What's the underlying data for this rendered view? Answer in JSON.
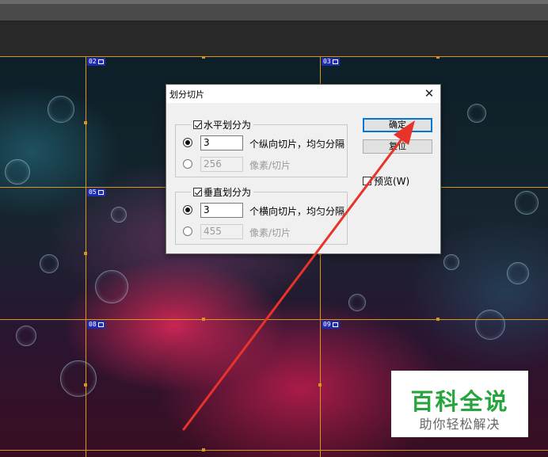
{
  "dialog": {
    "title": "划分切片",
    "close_glyph": "✕",
    "horizontal": {
      "label": "水平划分为",
      "count_value": "3",
      "count_unit": "个纵向切片，均匀分隔",
      "pixel_value": "256",
      "pixel_unit": "像素/切片"
    },
    "vertical": {
      "label": "垂直划分为",
      "count_value": "3",
      "count_unit": "个横向切片，均匀分隔",
      "pixel_value": "455",
      "pixel_unit": "像素/切片"
    },
    "ok_label": "确定",
    "reset_label": "复位",
    "preview_label": "预览(W)"
  },
  "slices": {
    "s02": "02",
    "s03": "03",
    "s05": "05",
    "s08": "08",
    "s09": "09"
  },
  "watermark": {
    "title": "百科全说",
    "subtitle": "助你轻松解决"
  },
  "colors": {
    "guide": "#d8961e",
    "slice_label_bg": "#1e2bb3",
    "arrow": "#e8332a",
    "watermark_green": "#25a53c"
  }
}
